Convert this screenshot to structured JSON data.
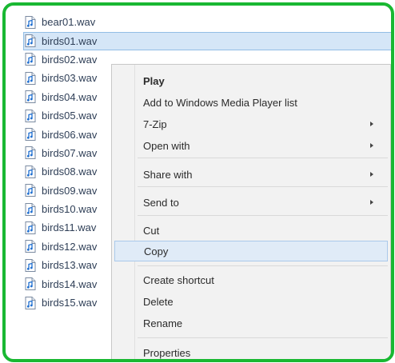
{
  "files": [
    {
      "name": "bear01.wav",
      "icon": "audio-file-icon",
      "selected": false
    },
    {
      "name": "birds01.wav",
      "icon": "audio-file-icon",
      "selected": true
    },
    {
      "name": "birds02.wav",
      "icon": "audio-file-icon",
      "selected": false
    },
    {
      "name": "birds03.wav",
      "icon": "audio-file-icon",
      "selected": false
    },
    {
      "name": "birds04.wav",
      "icon": "audio-file-icon",
      "selected": false
    },
    {
      "name": "birds05.wav",
      "icon": "audio-file-icon",
      "selected": false
    },
    {
      "name": "birds06.wav",
      "icon": "audio-file-icon",
      "selected": false
    },
    {
      "name": "birds07.wav",
      "icon": "audio-file-icon",
      "selected": false
    },
    {
      "name": "birds08.wav",
      "icon": "audio-file-icon",
      "selected": false
    },
    {
      "name": "birds09.wav",
      "icon": "audio-file-icon",
      "selected": false
    },
    {
      "name": "birds10.wav",
      "icon": "audio-file-icon",
      "selected": false
    },
    {
      "name": "birds11.wav",
      "icon": "audio-file-icon",
      "selected": false
    },
    {
      "name": "birds12.wav",
      "icon": "audio-file-icon",
      "selected": false
    },
    {
      "name": "birds13.wav",
      "icon": "audio-file-icon",
      "selected": false
    },
    {
      "name": "birds14.wav",
      "icon": "audio-file-icon",
      "selected": false
    },
    {
      "name": "birds15.wav",
      "icon": "audio-file-icon",
      "selected": false
    }
  ],
  "context_menu": {
    "items": [
      {
        "label": "Play",
        "bold": true
      },
      {
        "label": "Add to Windows Media Player list"
      },
      {
        "label": "7-Zip",
        "submenu": true
      },
      {
        "label": "Open with",
        "submenu": true
      },
      {
        "label": "Share with",
        "submenu": true
      },
      {
        "label": "Send to",
        "submenu": true
      },
      {
        "label": "Cut"
      },
      {
        "label": "Copy",
        "highlighted": true
      },
      {
        "label": "Create shortcut"
      },
      {
        "label": "Delete"
      },
      {
        "label": "Rename"
      },
      {
        "label": "Properties"
      }
    ]
  },
  "colors": {
    "frame_border": "#19b832",
    "selection_fill": "#d5e6f7",
    "menu_highlight": "#e0ebf7",
    "menu_background": "#f2f2f2"
  }
}
